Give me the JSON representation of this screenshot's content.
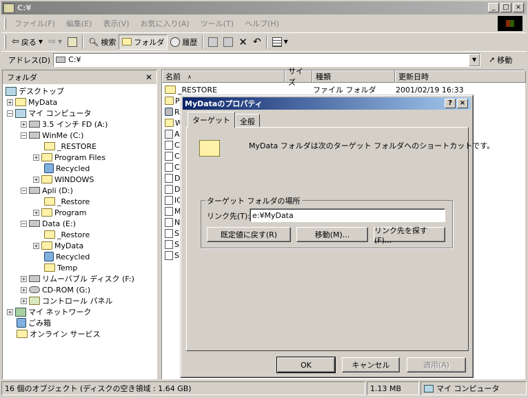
{
  "window": {
    "title": "C:¥",
    "icon": "folder-window-icon"
  },
  "menu": [
    "ファイル(F)",
    "編集(E)",
    "表示(V)",
    "お気に入り(A)",
    "ツール(T)",
    "ヘルプ(H)"
  ],
  "toolbar": {
    "back": "戻る",
    "search": "検索",
    "folders": "フォルダ",
    "history": "履歴"
  },
  "address": {
    "label": "アドレス(D)",
    "value": "C:¥",
    "go": "移動"
  },
  "folder_pane": {
    "title": "フォルダ",
    "tree": [
      {
        "label": "デスクトップ"
      },
      {
        "label": "MyData"
      },
      {
        "label": "マイ コンピュータ"
      },
      {
        "label": "3.5 インチ FD (A:)"
      },
      {
        "label": "WinMe (C:)"
      },
      {
        "label": "_RESTORE"
      },
      {
        "label": "Program Files"
      },
      {
        "label": "Recycled"
      },
      {
        "label": "WINDOWS"
      },
      {
        "label": "Apli (D:)"
      },
      {
        "label": "_Restore"
      },
      {
        "label": "Program"
      },
      {
        "label": "Data (E:)"
      },
      {
        "label": "_Restore"
      },
      {
        "label": "MyData"
      },
      {
        "label": "Recycled"
      },
      {
        "label": "Temp"
      },
      {
        "label": "リムーバブル ディスク (F:)"
      },
      {
        "label": "CD-ROM (G:)"
      },
      {
        "label": "コントロール パネル"
      },
      {
        "label": "マイ ネットワーク"
      },
      {
        "label": "ごみ箱"
      },
      {
        "label": "オンライン サービス"
      }
    ]
  },
  "file_list": {
    "columns": [
      "名前",
      "サイズ",
      "種類",
      "更新日時"
    ],
    "first_row": {
      "name": "_RESTORE",
      "type": "ファイル フォルダ",
      "modified": "2001/02/19 16:33"
    },
    "partial_rows": [
      "P",
      "R",
      "W",
      "A",
      "C",
      "C",
      "C",
      "D",
      "D",
      "IC",
      "M",
      "N",
      "S",
      "S",
      "S"
    ]
  },
  "status": {
    "objects": "16 個のオブジェクト (ディスクの空き領域 : 1.64 GB)",
    "size": "1.13 MB",
    "location": "マイ コンピュータ"
  },
  "dialog": {
    "title": "MyDataのプロパティ",
    "tabs": [
      "ターゲット",
      "全般"
    ],
    "description": "MyData フォルダは次のターゲット フォルダへのショートカットです。",
    "group_label": "ターゲット フォルダの場所",
    "link_label": "リンク先(T):",
    "link_value": "e:¥MyData",
    "btn_restore": "既定値に戻す(R)",
    "btn_move": "移動(M)...",
    "btn_find": "リンク先を探す(F)...",
    "ok": "OK",
    "cancel": "キャンセル",
    "apply": "適用(A)"
  }
}
